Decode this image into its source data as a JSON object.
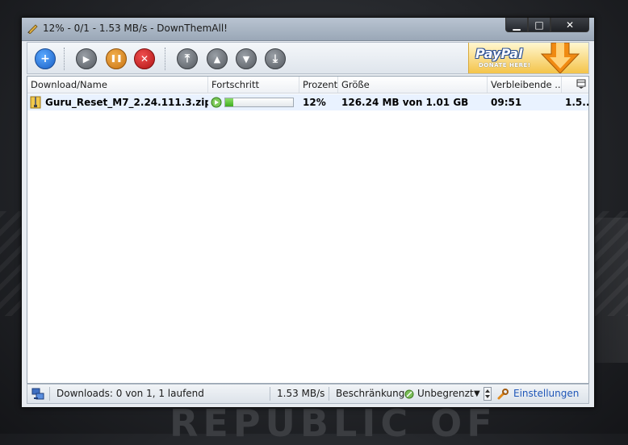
{
  "window": {
    "title": "12% - 0/1 - 1.53 MB/s - DownThemAll!",
    "controls": {
      "minimize": "▁",
      "maximize": "□",
      "close": "✕"
    }
  },
  "toolbar": {
    "buttons": [
      {
        "name": "add",
        "glyph": "+",
        "color": "#1a5fc4"
      },
      {
        "name": "resume",
        "glyph": "▶",
        "color": "#54595f"
      },
      {
        "name": "pause",
        "glyph": "❚❚",
        "color": "#c87312"
      },
      {
        "name": "cancel",
        "glyph": "✕",
        "color": "#b01515"
      },
      {
        "name": "move-top",
        "glyph": "⤒",
        "color": "#54595f"
      },
      {
        "name": "move-up",
        "glyph": "▲",
        "color": "#54595f"
      },
      {
        "name": "move-down",
        "glyph": "▼",
        "color": "#54595f"
      },
      {
        "name": "move-bottom",
        "glyph": "⤓",
        "color": "#54595f"
      }
    ],
    "paypal": {
      "brand": "PayPal",
      "sub": "DONATE HERE!"
    }
  },
  "table": {
    "headers": {
      "name": "Download/Name",
      "progress": "Fortschritt",
      "percent": "Prozent",
      "size": "Größe",
      "remaining": "Verbleibende ...",
      "speed": ""
    },
    "rows": [
      {
        "name": "Guru_Reset_M7_2.24.111.3.zip",
        "progress": 0.12,
        "percent": "12%",
        "size": "126.24 MB von 1.01 GB",
        "remaining": "09:51",
        "speed": "1.5..."
      }
    ]
  },
  "status": {
    "downloads": "Downloads: 0 von 1, 1 laufend",
    "speed": "1.53 MB/s",
    "limit_label": "Beschränkung:",
    "limit_value": "Unbegrenzt",
    "settings": "Einstellungen"
  },
  "background": {
    "text": "REPUBLIC OF"
  },
  "colors": {
    "accent": "#1f56b8",
    "progress": "#3fae1f",
    "titlebar": "#9aa7b7"
  }
}
